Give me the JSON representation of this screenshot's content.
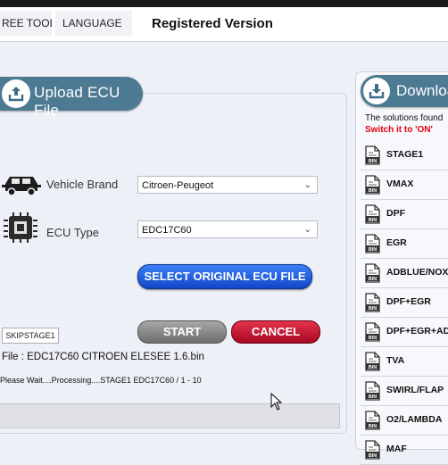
{
  "menubar": {
    "free_tools": "REE TOOLS",
    "language": "LANGUAGE",
    "title": "Registered Version"
  },
  "upload": {
    "label": "Upload ECU File"
  },
  "vehicle_brand": {
    "label": "Vehicle Brand",
    "value": "Citroen-Peugeot"
  },
  "ecu_type": {
    "label": "ECU Type",
    "value": "EDC17C60"
  },
  "buttons": {
    "select_file": "SELECT ORIGINAL ECU FILE",
    "skip": "SKIPSTAGE1",
    "start": "START",
    "cancel": "CANCEL"
  },
  "file_line": "File : EDC17C60 CITROEN ELESEE 1.6.bin",
  "status_line": "Please Wait....Processing....STAGE1 EDC17C60 / 1 - 10",
  "right": {
    "download_label": "Downloa",
    "solutions_text": "The solutions found",
    "switch_text": "Switch it to 'ON'",
    "file_icon_text": "BIN",
    "solutions": [
      {
        "name": "STAGE1"
      },
      {
        "name": "VMAX"
      },
      {
        "name": "DPF"
      },
      {
        "name": "EGR"
      },
      {
        "name": "ADBLUE/NOX"
      },
      {
        "name": "DPF+EGR"
      },
      {
        "name": "DPF+EGR+AD"
      },
      {
        "name": "TVA"
      },
      {
        "name": "SWIRL/FLAP"
      },
      {
        "name": "O2/LAMBDA"
      },
      {
        "name": "MAF"
      }
    ]
  },
  "colors": {
    "header_button": "#4d7a93",
    "select_button": "#1a5ce0",
    "start_button": "#8a8a8a",
    "cancel_button": "#c8102e",
    "switch_text": "#e30010"
  }
}
